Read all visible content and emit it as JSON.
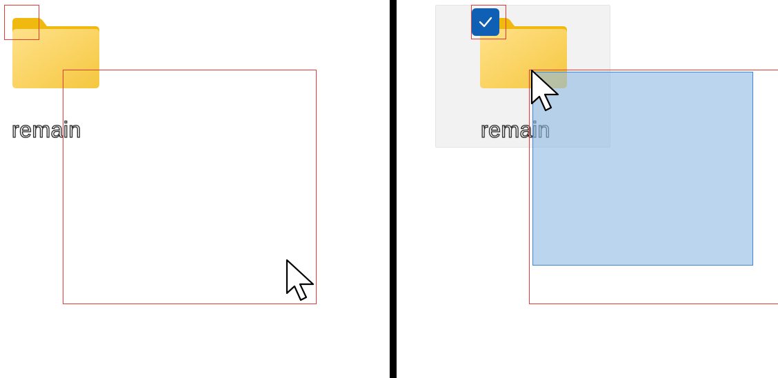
{
  "left_panel": {
    "folder": {
      "name": "remain",
      "selected": false,
      "icon": "folder-icon"
    },
    "cursor_icon": "arrow-cursor-icon"
  },
  "right_panel": {
    "folder": {
      "name": "remain",
      "selected": true,
      "icon": "folder-icon",
      "checkbox_icon": "checkmark-icon"
    },
    "cursor_icon": "arrow-cursor-icon",
    "selection_marquee": "drag-selection-rectangle"
  },
  "colors": {
    "folder_back": "#f0b90f",
    "folder_front": "#fbd667",
    "checkbox_blue": "#0f5fb5",
    "marquee_fill": "#b8d3ee",
    "marquee_border": "#3d86d6",
    "annotation_red": "#e53935",
    "divider": "#000000"
  }
}
